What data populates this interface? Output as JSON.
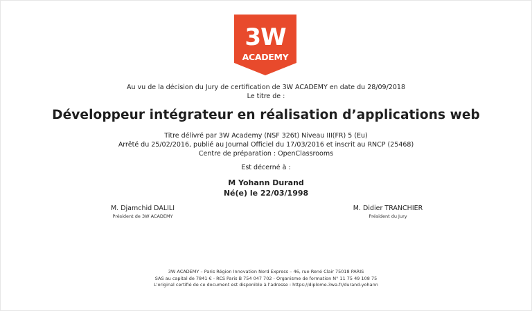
{
  "logo": {
    "primary": "3W",
    "secondary": "ACADEMY",
    "color": "#e84a2c",
    "text_color": "#ffffff"
  },
  "intro": {
    "line1": "Au vu de la décision du Jury de certification de 3W ACADEMY en date du 28/09/2018",
    "line2": "Le titre de :"
  },
  "title": "Développeur intégrateur en réalisation d’applications web",
  "details": {
    "line1": "Titre délivré par 3W Academy (NSF 326t) Niveau III(FR) 5 (Eu)",
    "line2": "Arrêté du 25/02/2016, publié au Journal Officiel du 17/03/2016 et inscrit au RNCP (25468)",
    "line3": "Centre de préparation : OpenClassrooms"
  },
  "awarded_label": "Est décerné à :",
  "recipient": {
    "name": "M Yohann Durand",
    "birth": "Né(e) le 22/03/1998"
  },
  "signers": {
    "left": {
      "name": "M. Djamchid DALILI",
      "role": "Président de 3W ACADEMY"
    },
    "right": {
      "name": "M. Didier TRANCHIER",
      "role": "Président du Jury"
    }
  },
  "footer": {
    "line1": "3W ACADEMY – Paris Région Innovation Nord Express – 46, rue René Clair 75018 PARIS",
    "line2": "SAS au capital de 7841 € - RCS Paris B 754 047 702 - Organisme de formation N° 11 75 49 108 75",
    "line3": "L'original certifié de ce document est disponible à l'adresse : https://diplome.3wa.fr/durand-yohann"
  }
}
